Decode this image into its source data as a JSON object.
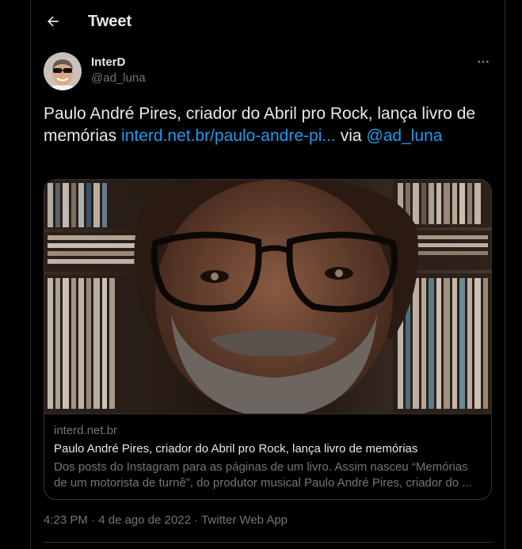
{
  "header": {
    "title": "Tweet",
    "back_icon": "arrow-left-icon"
  },
  "author": {
    "display_name": "InterD",
    "handle": "@ad_luna",
    "more_icon": "more-horizontal-icon"
  },
  "tweet": {
    "text_before": "Paulo André Pires, criador do Abril pro Rock, lança livro de memórias ",
    "link": "interd.net.br/paulo-andre-pi...",
    "text_middle": " via ",
    "mention": "@ad_luna"
  },
  "card": {
    "domain": "interd.net.br",
    "title": "Paulo André Pires, criador do Abril pro Rock, lança livro de memórias",
    "description": "Dos posts do Instagram para as páginas de um livro. Assim nasceu “Memórias de um motorista de turnê”, do produtor musical Paulo André Pires, criador do ..."
  },
  "meta": {
    "time": "4:23 PM",
    "separator": "·",
    "date": "4 de ago de 2022",
    "source": "Twitter Web App"
  },
  "colors": {
    "background": "#000000",
    "text": "#e7e9ea",
    "secondary": "#71767b",
    "link": "#1d9bf0",
    "border": "#2f3336"
  }
}
